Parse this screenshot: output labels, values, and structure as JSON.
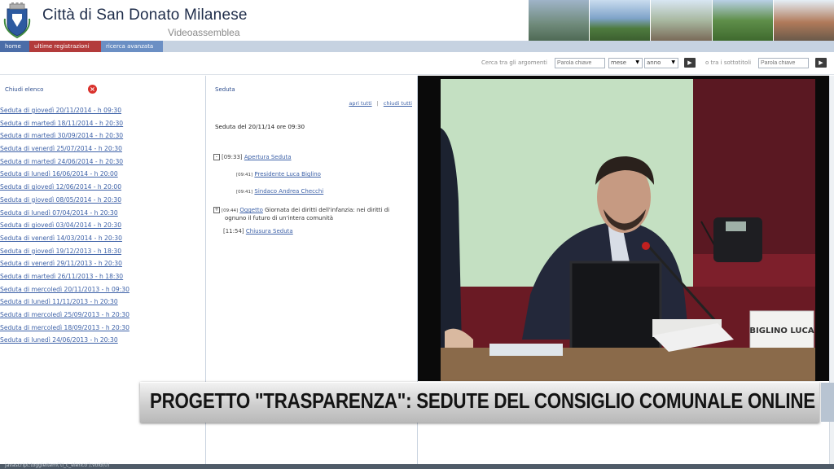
{
  "header": {
    "title": "Città di San Donato Milanese",
    "subtitle": "Videoassemblea",
    "logo_icon": "coat-of-arms-icon"
  },
  "nav": {
    "home": "home",
    "recent": "ultime registrazioni",
    "advanced": "ricerca avanzata"
  },
  "search": {
    "label_topics": "Cerca tra gli argomenti",
    "keyword_placeholder": "Parola chiave",
    "month_value": "mese",
    "year_value": "anno",
    "label_subtopics": "o tra i sottotitoli",
    "keyword2_placeholder": "Parola chiave",
    "go_icon": "play-arrow-icon"
  },
  "left_panel": {
    "close_label": "Chiudi elenco",
    "close_icon": "close-icon",
    "sessions": [
      "Seduta di giovedì 20/11/2014 - h 09:30",
      "Seduta di martedì 18/11/2014 - h 20:30",
      "Seduta di martedì 30/09/2014 - h 20:30",
      "Seduta di venerdì 25/07/2014 - h 20:30",
      "Seduta di martedì 24/06/2014 - h 20:30",
      "Seduta di lunedì 16/06/2014 - h 20:00",
      "Seduta di giovedì 12/06/2014 - h 20:00",
      "Seduta di giovedì 08/05/2014 - h 20:30",
      "Seduta di lunedì 07/04/2014 - h 20:30",
      "Seduta di giovedì 03/04/2014 - h 20:30",
      "Seduta di venerdì 14/03/2014 - h 20:30",
      "Seduta di giovedì 19/12/2013 - h 18:30",
      "Seduta di venerdì 29/11/2013 - h 20:30",
      "Seduta di martedì 26/11/2013 - h 18:30",
      "Seduta di mercoledì 20/11/2013 - h 09:30",
      "Seduta di lunedì 11/11/2013 - h 20:30",
      "Seduta di mercoledì 25/09/2013 - h 20:30",
      "Seduta di mercoledì 18/09/2013 - h 20:30",
      "Seduta di lunedì 24/06/2013 - h 20:30"
    ]
  },
  "mid_panel": {
    "title": "Seduta",
    "open_all": "apri tutti",
    "close_all": "chiudi tutti",
    "session_date": "Seduta del 20/11/14 ore 09:30",
    "agenda": [
      {
        "time": "[09:33]",
        "label": "Apertura Seduta",
        "toggle": "-"
      },
      {
        "time": "[09:41]",
        "label": "Presidente Luca Biglino"
      },
      {
        "time": "[09:41]",
        "label": "Sindaco Andrea Checchi"
      },
      {
        "time": "[09:44]",
        "label": "Oggetto",
        "text": "Giornata dei diritti dell'infanzia: nei diritti di",
        "text2": "ognuno il futuro di un'intera comunità",
        "toggle": "+"
      },
      {
        "time": "[11:54]",
        "label": "Chiusura Seduta"
      }
    ]
  },
  "video": {
    "nameplate": "BIGLINO LUCA"
  },
  "banner": {
    "text": "PROGETTO \"TRASPARENZA\": SEDUTE DEL CONSIGLIO COMUNALE ONLINE"
  },
  "statusbar": {
    "text": "javascript:toggleItem('tl_c_elenco');void(0)"
  },
  "colors": {
    "nav_home": "#4b6da8",
    "nav_recent": "#b33b3b",
    "nav_search": "#6b8fc4",
    "link": "#3e62a8",
    "close": "#d9312c"
  }
}
